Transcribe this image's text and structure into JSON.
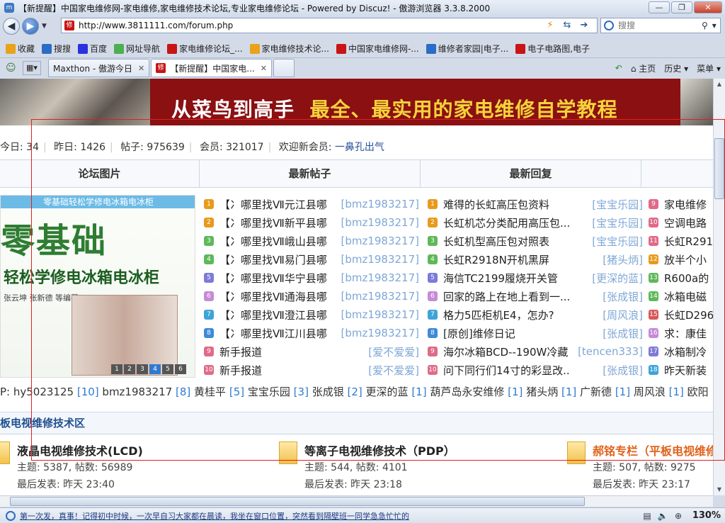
{
  "window": {
    "title": "【新提醒】中国家电维修网-家电维修,家电维修技术论坛,专业家电维修论坛 - Powered by Discuz! - 傲游浏览器 3.3.8.2000",
    "app_icon": "m"
  },
  "nav": {
    "url": "http://www.3811111.com/forum.php",
    "search_placeholder": "搜搜",
    "favicon": "修"
  },
  "bookmarks": [
    {
      "label": "收藏",
      "icon": "star-icon",
      "color": "#e8a21c"
    },
    {
      "label": "搜搜",
      "icon": "soso-icon",
      "color": "#2b6cc4"
    },
    {
      "label": "百度",
      "icon": "baidu-icon",
      "color": "#2932e1"
    },
    {
      "label": "网址导航",
      "icon": "nav-icon",
      "color": "#4caf50"
    },
    {
      "label": "家电维修论坛_...",
      "icon": "site-icon",
      "color": "#c81414"
    },
    {
      "label": "家电维修技术论...",
      "icon": "site-icon",
      "color": "#e8a21c"
    },
    {
      "label": "中国家电维修网-...",
      "icon": "site-icon",
      "color": "#c81414"
    },
    {
      "label": "维修者家园|电子...",
      "icon": "site-icon",
      "color": "#2b6cc4"
    },
    {
      "label": "电子电路图,电子",
      "icon": "site-icon",
      "color": "#c81414"
    }
  ],
  "tabs": [
    {
      "label": "Maxthon - 傲游今日"
    },
    {
      "label": "【新提醒】中国家电..."
    }
  ],
  "menu": {
    "home": "主页",
    "history": "历史",
    "menu": "菜单"
  },
  "banner": {
    "slogan_white": "从菜鸟到高手",
    "slogan_yellow": "最全、最实用的家电维修自学教程"
  },
  "stats": {
    "today_label": "今日:",
    "today": "34",
    "yesterday_label": "昨日:",
    "yesterday": "1426",
    "posts_label": "帖子:",
    "posts": "975639",
    "members_label": "会员:",
    "members": "321017",
    "welcome_label": "欢迎新会员:",
    "new_member": "一鼻孔出气"
  },
  "grid_headers": [
    "论坛图片",
    "最新帖子",
    "最新回复"
  ],
  "pic": {
    "caption": "零基础轻松学修电冰箱电冰柜",
    "big": "零基础",
    "sub": "轻松学修电冰箱电冰柜",
    "authors": "张云坤  张新德  等编著",
    "dots": [
      "1",
      "2",
      "3",
      "4",
      "5",
      "6"
    ]
  },
  "new_posts": [
    {
      "n": "1",
      "title": "【冫哪里找Ⅶ元江县哪",
      "user": "[bmz1983217]"
    },
    {
      "n": "2",
      "title": "【冫哪里找Ⅶ新平县哪",
      "user": "[bmz1983217]"
    },
    {
      "n": "3",
      "title": "【冫哪里找Ⅶ峨山县哪",
      "user": "[bmz1983217]"
    },
    {
      "n": "4",
      "title": "【冫哪里找Ⅶ易门县哪",
      "user": "[bmz1983217]"
    },
    {
      "n": "5",
      "title": "【冫哪里找Ⅶ华宁县哪",
      "user": "[bmz1983217]"
    },
    {
      "n": "6",
      "title": "【冫哪里找Ⅶ通海县哪",
      "user": "[bmz1983217]"
    },
    {
      "n": "7",
      "title": "【冫哪里找Ⅶ澄江县哪",
      "user": "[bmz1983217]"
    },
    {
      "n": "8",
      "title": "【冫哪里找Ⅶ江川县哪",
      "user": "[bmz1983217]"
    },
    {
      "n": "9",
      "title": "新手报道",
      "user": "[爱不爱爱]"
    },
    {
      "n": "10",
      "title": "新手报道",
      "user": "[爱不爱爱]"
    }
  ],
  "new_replies": [
    {
      "n": "1",
      "title": "难得的长虹高压包资料",
      "user": "[宝宝乐园]"
    },
    {
      "n": "2",
      "title": "长虹机芯分类配用高压包...",
      "user": "[宝宝乐园]"
    },
    {
      "n": "3",
      "title": "长虹机型高压包对照表",
      "user": "[宝宝乐园]"
    },
    {
      "n": "4",
      "title": "长虹R2918N开机黑屏",
      "user": "[猪头炳]"
    },
    {
      "n": "5",
      "title": "海信TC2199履烧开关管",
      "user": "[更深的蓝]"
    },
    {
      "n": "6",
      "title": "回家的路上在地上看到一...",
      "user": "[张成银]"
    },
    {
      "n": "7",
      "title": "格力5匹柜机E4，怎办?",
      "user": "[周风浪]"
    },
    {
      "n": "8",
      "title": "[原创]维修日记",
      "user": "[张成银]"
    },
    {
      "n": "9",
      "title": "海尔冰箱BCD--190W冷藏",
      "user": "[tencen333]"
    },
    {
      "n": "10",
      "title": "问下同行们14寸的彩显改...",
      "user": "[张成银]"
    }
  ],
  "hot": [
    {
      "n": "9",
      "title": "家电维修"
    },
    {
      "n": "10",
      "title": "空调电路"
    },
    {
      "n": "11",
      "title": "长虹R291"
    },
    {
      "n": "12",
      "title": "放半个小"
    },
    {
      "n": "13",
      "title": "R600a的"
    },
    {
      "n": "14",
      "title": "冰箱电磁"
    },
    {
      "n": "15",
      "title": "长虹D296"
    },
    {
      "n": "16",
      "title": "求：康佳"
    },
    {
      "n": "17",
      "title": "冰箱制冷"
    },
    {
      "n": "18",
      "title": "昨天新装"
    }
  ],
  "top_users": [
    {
      "name": "P: hy5023125",
      "count": "[10]"
    },
    {
      "name": "bmz1983217",
      "count": "[8]"
    },
    {
      "name": "黄桂平",
      "count": "[5]"
    },
    {
      "name": "宝宝乐园",
      "count": "[3]"
    },
    {
      "name": "张成银",
      "count": "[2]"
    },
    {
      "name": "更深的蓝",
      "count": "[1]"
    },
    {
      "name": "葫芦岛永安维修",
      "count": "[1]"
    },
    {
      "name": "猪头炳",
      "count": "[1]"
    },
    {
      "name": "广新德",
      "count": "[1]"
    },
    {
      "name": "周风浪",
      "count": "[1]"
    },
    {
      "name": "欧阳",
      "count": ""
    }
  ],
  "section": {
    "title": "板电视维修技术区"
  },
  "forums": [
    {
      "name": "液晶电视维修技术(LCD)",
      "stats": "主题: 5387, 帖数: 56989",
      "last": "最后发表: 昨天 23:40",
      "color": "#222"
    },
    {
      "name": "等离子电视维修技术（PDP）",
      "stats": "主题: 544, 帖数: 4101",
      "last": "最后发表: 昨天 23:18",
      "color": "#222"
    },
    {
      "name": "郝铭专栏（平板电视维修）",
      "stats": "主题: 507, 帖数: 9275",
      "last": "最后发表: 昨天 23:17",
      "color": "#e0621b"
    }
  ],
  "status": {
    "message": "第一次发，真事！记得初中时候，一次早自习大家都在晨读，我坐在窗口位置，突然看到隔壁班一同学急急忙忙的",
    "zoom": "130%"
  },
  "num_colors": [
    "#e89a1c",
    "#e89a1c",
    "#5fb85a",
    "#5fb85a",
    "#7d7ad8",
    "#c68ad8",
    "#3fa3d8",
    "#3f8ad8",
    "#e06a8a",
    "#e06a8a",
    "#e06a8a",
    "#e89a1c",
    "#5fb85a",
    "#5fb85a",
    "#d85a5a",
    "#c68ad8",
    "#7d7ad8",
    "#3fa3d8"
  ]
}
